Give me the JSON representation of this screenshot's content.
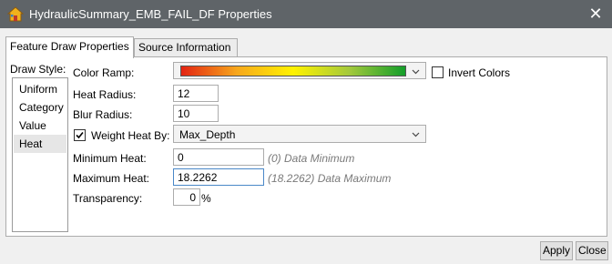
{
  "window": {
    "title": "HydraulicSummary_EMB_FAIL_DF Properties",
    "close_glyph": "✕",
    "icon": "app-house-icon"
  },
  "tabs": [
    {
      "label": "Feature Draw Properties",
      "active": true
    },
    {
      "label": "Source Information",
      "active": false
    }
  ],
  "draw_style": {
    "label": "Draw Style:",
    "items": [
      "Uniform",
      "Category",
      "Value",
      "Heat"
    ],
    "selected": "Heat"
  },
  "color_ramp": {
    "label": "Color Ramp:",
    "gradient_colors": [
      "#e32312",
      "#f7a81c",
      "#fff200",
      "#a4c93c",
      "#139e2a"
    ]
  },
  "invert_colors": {
    "label": "Invert Colors",
    "checked": false
  },
  "heat_radius": {
    "label": "Heat Radius:",
    "value": "12"
  },
  "blur_radius": {
    "label": "Blur Radius:",
    "value": "10"
  },
  "weight_heat_by": {
    "label": "Weight Heat By:",
    "checked": true,
    "value": "Max_Depth"
  },
  "minimum_heat": {
    "label": "Minimum Heat:",
    "value": "0",
    "hint": "(0) Data Minimum"
  },
  "maximum_heat": {
    "label": "Maximum Heat:",
    "value": "18.2262",
    "hint": "(18.2262) Data Maximum"
  },
  "transparency": {
    "label": "Transparency:",
    "value": "0",
    "unit": "%"
  },
  "buttons": {
    "apply": "Apply",
    "close": "Close"
  }
}
